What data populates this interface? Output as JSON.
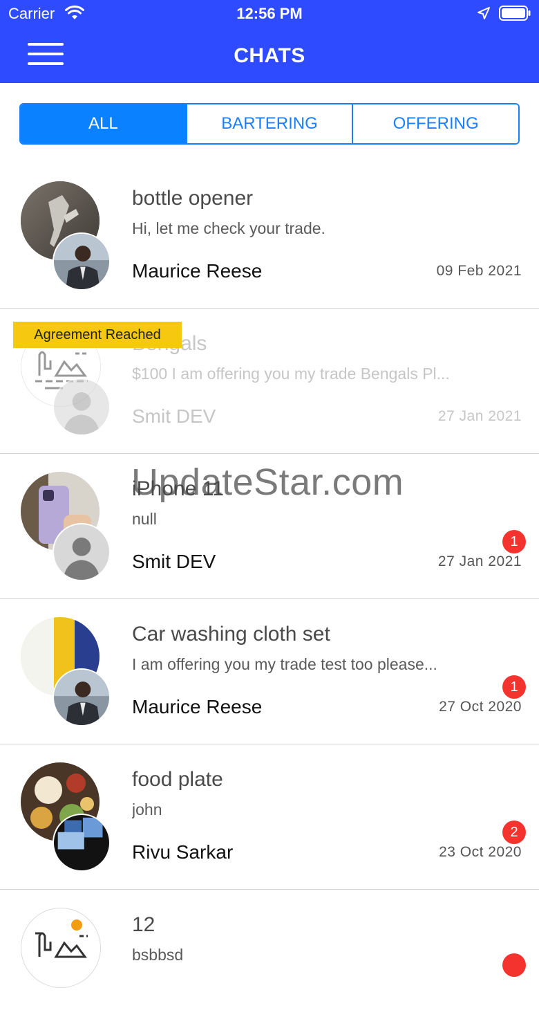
{
  "status_bar": {
    "carrier": "Carrier",
    "time": "12:56 PM"
  },
  "nav": {
    "title": "CHATS",
    "menu_icon": "hamburger-menu-icon"
  },
  "tabs": [
    {
      "label": "ALL",
      "active": true
    },
    {
      "label": "BARTERING",
      "active": false
    },
    {
      "label": "OFFERING",
      "active": false
    }
  ],
  "chats": [
    {
      "title": "bottle opener",
      "preview": "Hi, let me check your trade.",
      "sender": "Maurice Reese",
      "date": "09 Feb 2021",
      "badge": "",
      "ribbon": "",
      "faded": false
    },
    {
      "title": "Bengals",
      "preview": "$100 I am offering you my trade Bengals Pl...",
      "sender": "Smit DEV",
      "date": "27 Jan 2021",
      "badge": "",
      "ribbon": "Agreement Reached",
      "faded": true
    },
    {
      "title": "iPhone 11",
      "preview": "null",
      "sender": "Smit DEV",
      "date": "27 Jan 2021",
      "badge": "1",
      "ribbon": "",
      "faded": false
    },
    {
      "title": "Car washing cloth set",
      "preview": " I am offering you my trade test too please...",
      "sender": "Maurice Reese",
      "date": "27 Oct 2020",
      "badge": "1",
      "ribbon": "",
      "faded": false
    },
    {
      "title": "food plate",
      "preview": "john",
      "sender": "Rivu Sarkar",
      "date": "23 Oct 2020",
      "badge": "2",
      "ribbon": "",
      "faded": false
    },
    {
      "title": "12",
      "preview": "bsbbsd",
      "sender": "",
      "date": "",
      "badge": "",
      "ribbon": "",
      "faded": false
    }
  ],
  "watermark": "UpdateStar.com",
  "colors": {
    "header": "#2f4bff",
    "tab_active": "#0a82ff",
    "badge": "#f5332e",
    "ribbon": "#f6c910"
  }
}
